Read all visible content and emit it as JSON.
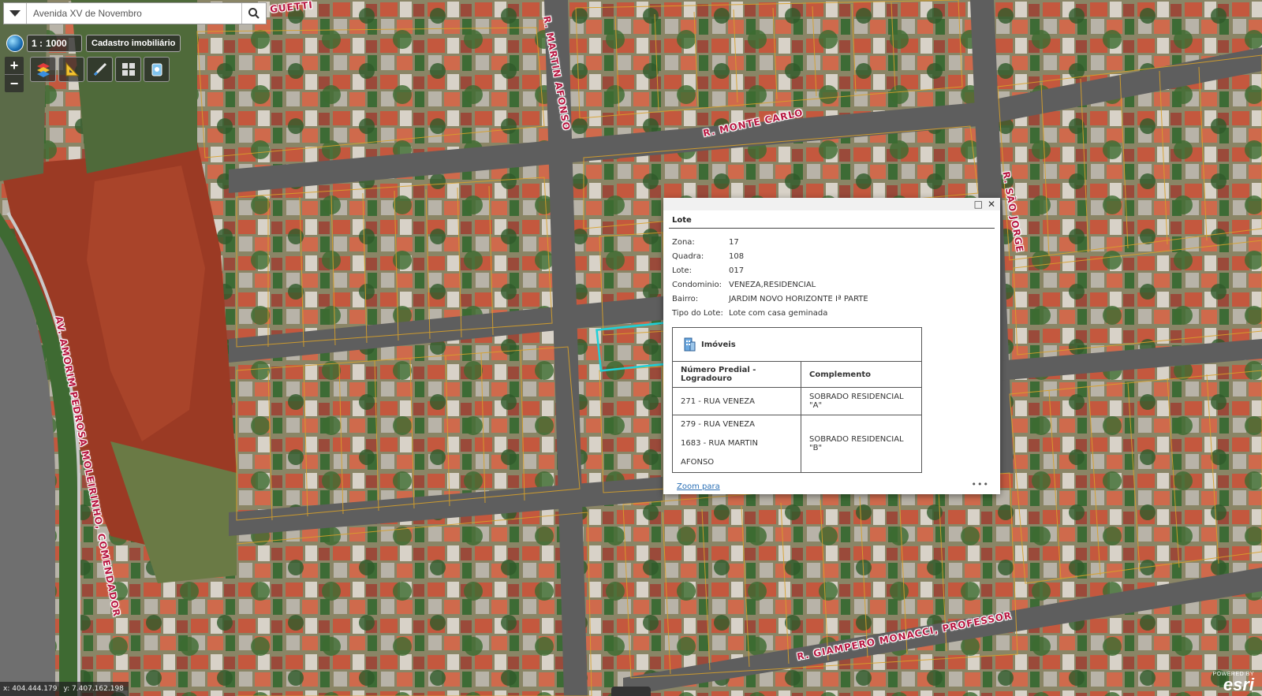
{
  "search": {
    "value": "Avenida XV de Novembro",
    "placeholder": ""
  },
  "scale": {
    "prefix": "1 :",
    "value": "1000"
  },
  "layer": {
    "label": "Cadastro imobiliário"
  },
  "zoom": {
    "in": "+",
    "out": "−"
  },
  "toolbar": {
    "icons": [
      "layers-icon",
      "measure-icon",
      "draw-icon",
      "grid-icon",
      "bookmark-icon"
    ]
  },
  "streets": {
    "guetti": "GUETTI",
    "martin_afonso": "R. MARTIN AFONSO",
    "monte_carlo": "R. MONTE CARLO",
    "sao_jorge": "R. SÃO JORGE",
    "amorim": "AV. AMORIM PEDROSA MOLEIRINHO, COMENDADOR",
    "giampero": "R. GIAMPERO MONACCI, PROFESSOR"
  },
  "popup": {
    "title": "Lote",
    "attributes": [
      {
        "key": "Zona:",
        "value": "17"
      },
      {
        "key": "Quadra:",
        "value": "108"
      },
      {
        "key": "Lote:",
        "value": "017"
      },
      {
        "key": "Condominio:",
        "value": "VENEZA,RESIDENCIAL"
      },
      {
        "key": "Bairro:",
        "value": "JARDIM NOVO HORIZONTE Iª PARTE"
      },
      {
        "key": "Tipo do Lote:",
        "value": "Lote com casa geminada"
      }
    ],
    "table": {
      "title": "Imóveis",
      "columns": [
        "Número Predial - Logradouro",
        "Complemento"
      ],
      "rows": [
        {
          "addresses": [
            "271 - RUA VENEZA"
          ],
          "complement": "SOBRADO RESIDENCIAL \"A\""
        },
        {
          "addresses": [
            "279 - RUA VENEZA",
            "1683 - RUA MARTIN AFONSO"
          ],
          "complement": "SOBRADO RESIDENCIAL \"B\""
        }
      ]
    },
    "zoom_link": "Zoom para",
    "more": "•••"
  },
  "coords": {
    "x": "x: 404.444.179",
    "y": "y: 7.407.162.198"
  },
  "attribution": {
    "powered": "POWERED BY",
    "brand": "esri"
  },
  "colors": {
    "highlight": "#1fd0d8",
    "parcel_line": "#d8a12a",
    "street_label": "#b81842",
    "link": "#2a6fb5"
  }
}
